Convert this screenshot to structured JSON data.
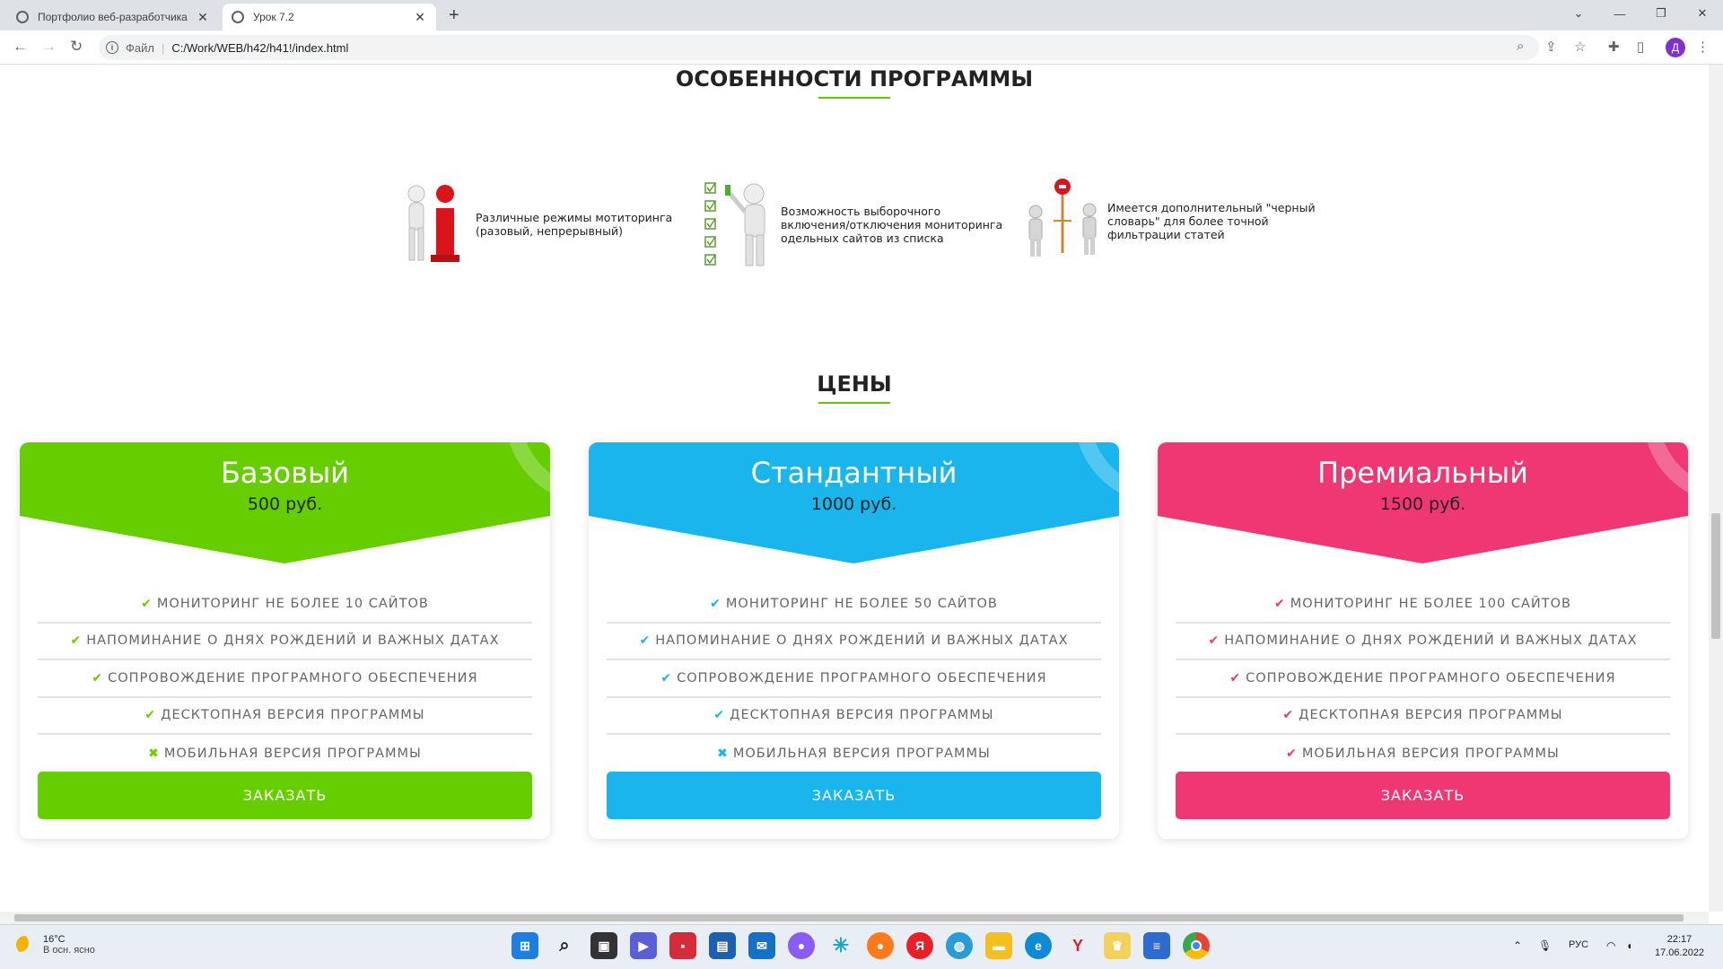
{
  "browser": {
    "tabs": [
      {
        "title": "Портфолио веб-разработчика",
        "active": false
      },
      {
        "title": "Урок 7.2",
        "active": true
      }
    ],
    "new_tab": "+",
    "omnibox": {
      "scheme_label": "Файл",
      "url": "C:/Work/WEB/h42/h41!/index.html"
    },
    "profile_initial": "Д"
  },
  "features": {
    "title": "ОСОБЕННОСТИ ПРОГРАММЫ",
    "items": [
      {
        "text": "Различные режимы мотиторинга (разовый, непрерывный)"
      },
      {
        "text": "Возможность выборочного включения/отключения мониторинга одельных сайтов из списка"
      },
      {
        "text": "Имеется дополнительный \"черный словарь\" для более точной фильтрации статей"
      }
    ]
  },
  "pricing": {
    "title": "ЦЕНЫ",
    "plans": [
      {
        "name": "Базовый",
        "price": "500 руб.",
        "color": "#65cd00",
        "button": "ЗАКАЗАТЬ",
        "features": [
          {
            "mark": "✔",
            "text": "МОНИТОРИНГ НЕ БОЛЕЕ 10 САЙТОВ"
          },
          {
            "mark": "✔",
            "text": "НАПОМИНАНИЕ О ДНЯХ РОЖДЕНИЙ И ВАЖНЫХ ДАТАХ"
          },
          {
            "mark": "✔",
            "text": "СОПРОВОЖДЕНИЕ ПРОГРАМНОГО ОБЕСПЕЧЕНИЯ"
          },
          {
            "mark": "✔",
            "text": "ДЕСКТОПНАЯ ВЕРСИЯ ПРОГРАММЫ"
          },
          {
            "mark": "✖",
            "text": "МОБИЛЬНАЯ ВЕРСИЯ ПРОГРАММЫ"
          }
        ]
      },
      {
        "name": "Стандантный",
        "price": "1000 руб.",
        "color": "#19b5ec",
        "button": "ЗАКАЗАТЬ",
        "features": [
          {
            "mark": "✔",
            "text": "МОНИТОРИНГ НЕ БОЛЕЕ 50 САЙТОВ"
          },
          {
            "mark": "✔",
            "text": "НАПОМИНАНИЕ О ДНЯХ РОЖДЕНИЙ И ВАЖНЫХ ДАТАХ"
          },
          {
            "mark": "✔",
            "text": "СОПРОВОЖДЕНИЕ ПРОГРАМНОГО ОБЕСПЕЧЕНИЯ"
          },
          {
            "mark": "✔",
            "text": "ДЕСКТОПНАЯ ВЕРСИЯ ПРОГРАММЫ"
          },
          {
            "mark": "✖",
            "text": "МОБИЛЬНАЯ ВЕРСИЯ ПРОГРАММЫ"
          }
        ]
      },
      {
        "name": "Премиальный",
        "price": "1500 руб.",
        "color": "#ef3873",
        "button": "ЗАКАЗАТЬ",
        "features": [
          {
            "mark": "✔",
            "text": "МОНИТОРИНГ НЕ БОЛЕЕ 100 САЙТОВ"
          },
          {
            "mark": "✔",
            "text": "НАПОМИНАНИЕ О ДНЯХ РОЖДЕНИЙ И ВАЖНЫХ ДАТАХ"
          },
          {
            "mark": "✔",
            "text": "СОПРОВОЖДЕНИЕ ПРОГРАМНОГО ОБЕСПЕЧЕНИЯ"
          },
          {
            "mark": "✔",
            "text": "ДЕСКТОПНАЯ ВЕРСИЯ ПРОГРАММЫ"
          },
          {
            "mark": "✔",
            "text": "МОБИЛЬНАЯ ВЕРСИЯ ПРОГРАММЫ"
          }
        ]
      }
    ]
  },
  "taskbar": {
    "weather": {
      "temp": "16°C",
      "desc": "В осн. ясно"
    },
    "lang": "РУС",
    "time": "22:17",
    "date": "17.06.2022"
  }
}
